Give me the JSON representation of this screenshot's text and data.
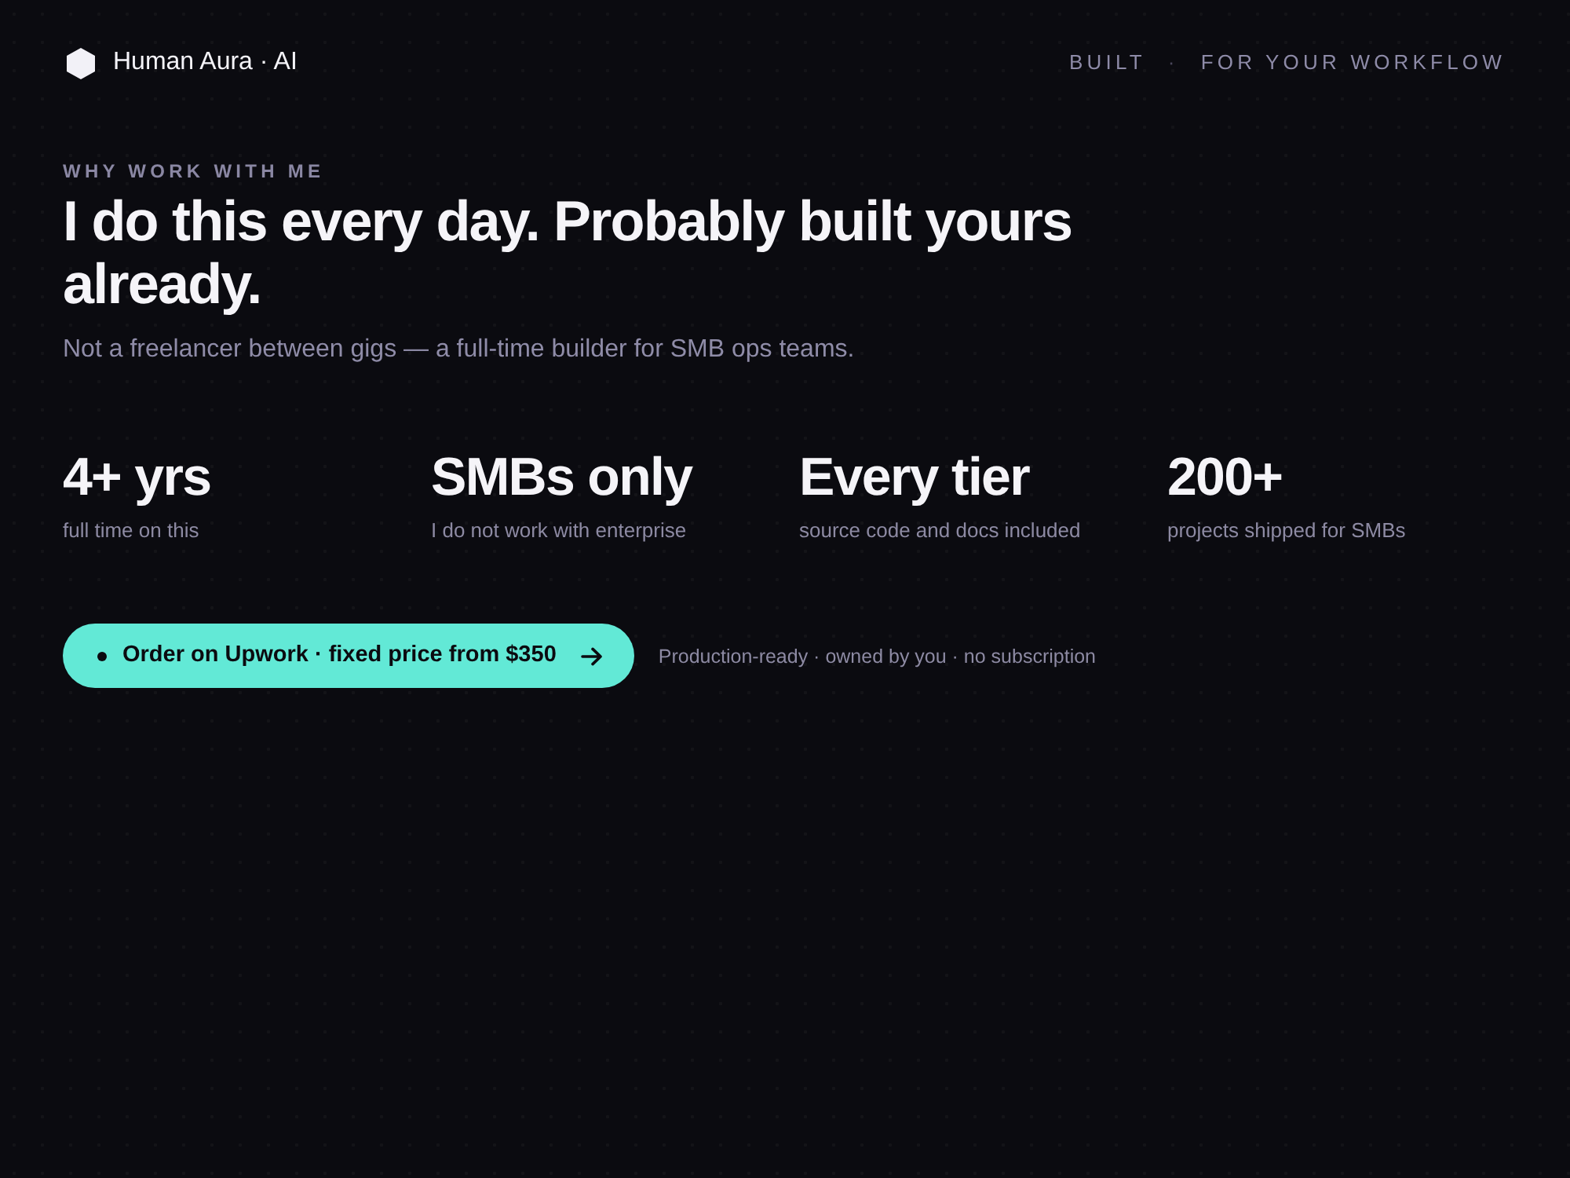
{
  "brand": {
    "name": "Human Aura · AI"
  },
  "tagline": {
    "parts": [
      "BUILT",
      "FOR YOUR WORKFLOW"
    ],
    "separator": "·"
  },
  "section": {
    "eyebrow": "WHY WORK WITH ME",
    "heading": "I do this every day. Probably built yours already.",
    "subheading": "Not a freelancer between gigs — a full-time builder for SMB ops teams."
  },
  "stats": [
    {
      "value": "4+ yrs",
      "label": "full time on this"
    },
    {
      "value": "SMBs only",
      "label": "I do not work with enterprise"
    },
    {
      "value": "Every tier",
      "label": "source code and docs included"
    },
    {
      "value": "200+",
      "label": "projects shipped for SMBs"
    }
  ],
  "cta": {
    "label": "Order on Upwork · fixed price from $350",
    "note": "Production-ready · owned by you · no subscription"
  }
}
